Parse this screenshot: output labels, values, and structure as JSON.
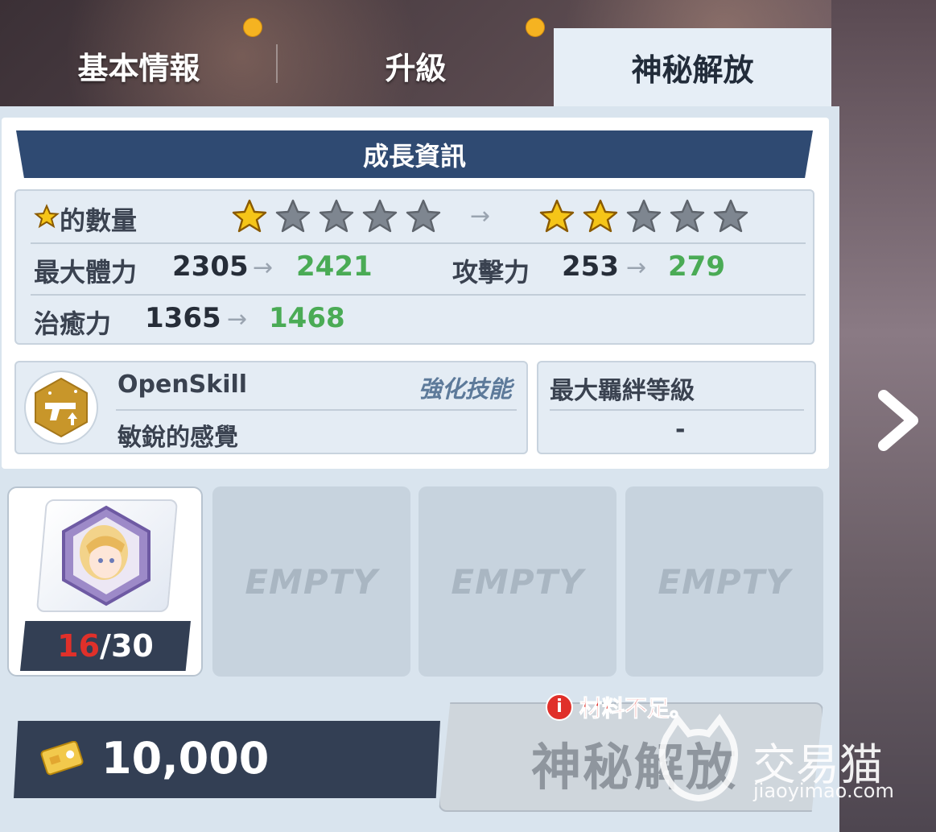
{
  "tabs": [
    {
      "label": "基本情報",
      "has_dot": true
    },
    {
      "label": "升級",
      "has_dot": true
    },
    {
      "label": "神秘解放",
      "active": true
    }
  ],
  "growth": {
    "title": "成長資訊",
    "star_label": "的數量",
    "stars_before": 1,
    "stars_after": 2,
    "stars_total": 5,
    "arrow": "→",
    "stats": [
      {
        "label": "最大體力",
        "from": "2305",
        "to": "2421"
      },
      {
        "label": "攻擊力",
        "from": "253",
        "to": "279"
      },
      {
        "label": "治癒力",
        "from": "1365",
        "to": "1468"
      }
    ]
  },
  "skill": {
    "name": "OpenSkill",
    "tag": "強化技能",
    "desc": "敏銳的感覺"
  },
  "bond": {
    "label": "最大羈絆等級",
    "value": "-"
  },
  "slots": {
    "current": "16",
    "sep": "/",
    "total": "30",
    "empty_label": "EMPTY"
  },
  "cost": {
    "amount": "10,000"
  },
  "action": {
    "warning": "材料不足。",
    "label": "神秘解放"
  },
  "watermark": {
    "text": "交易猫",
    "url": "jiaoyimao.com"
  },
  "colors": {
    "accent_green": "#4aab55",
    "banner_navy": "#2f4a72",
    "warning_red": "#e0302a",
    "star_gold": "#f5c518"
  }
}
